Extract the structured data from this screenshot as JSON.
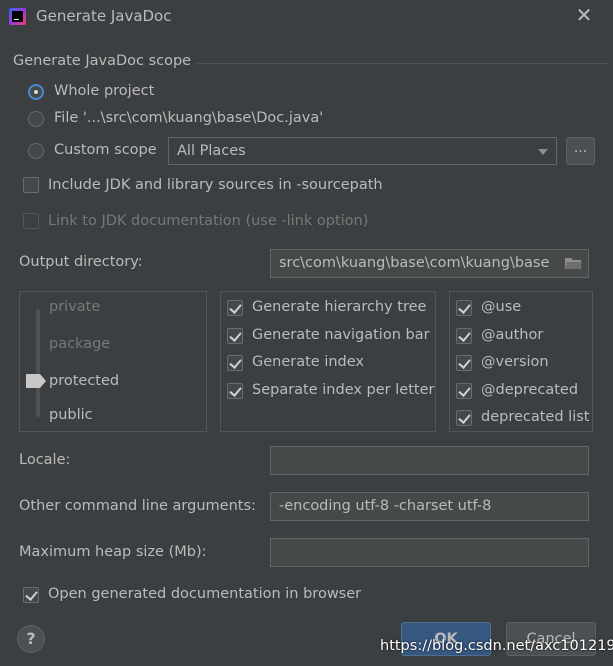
{
  "window": {
    "title": "Generate JavaDoc"
  },
  "scope": {
    "section_title": "Generate JavaDoc scope",
    "whole_project": "Whole project",
    "file": "File '...\\src\\com\\kuang\\base\\Doc.java'",
    "custom_scope": "Custom scope",
    "custom_scope_value": "All Places",
    "more_button": "...",
    "selected": "whole_project"
  },
  "options": {
    "include_jdk": "Include JDK and library sources in -sourcepath",
    "include_jdk_checked": false,
    "link_jdk": "Link to JDK documentation (use -link option)",
    "link_jdk_checked": false,
    "output_dir_label": "Output directory:",
    "output_dir_value": "src\\com\\kuang\\base\\com\\kuang\\base"
  },
  "visibility": {
    "levels": [
      "private",
      "package",
      "protected",
      "public"
    ],
    "selected": "protected"
  },
  "generate_options": [
    {
      "label": "Generate hierarchy tree",
      "checked": true
    },
    {
      "label": "Generate navigation bar",
      "checked": true
    },
    {
      "label": "Generate index",
      "checked": true
    },
    {
      "label": "Separate index per letter",
      "checked": true
    }
  ],
  "tags": [
    {
      "label": "@use",
      "checked": true
    },
    {
      "label": "@author",
      "checked": true
    },
    {
      "label": "@version",
      "checked": true
    },
    {
      "label": "@deprecated",
      "checked": true
    },
    {
      "label": "deprecated list",
      "checked": true
    }
  ],
  "fields": {
    "locale_label": "Locale:",
    "locale_value": "",
    "cmd_label": "Other command line arguments:",
    "cmd_value": "-encoding utf-8 -charset utf-8",
    "heap_label": "Maximum heap size (Mb):",
    "heap_value": ""
  },
  "open_browser": {
    "label": "Open generated documentation in browser",
    "checked": true
  },
  "buttons": {
    "help": "?",
    "ok": "OK",
    "cancel": "Cancel"
  },
  "watermark": "https://blog.csdn.net/axc101219",
  "colors": {
    "background": "#3c3f41",
    "accent": "#4a88c7",
    "ok_button": "#365880"
  },
  "icons": {
    "app": "intellij-icon",
    "close": "close-icon",
    "folder": "folder-icon",
    "dropdown": "chevron-down-icon"
  }
}
